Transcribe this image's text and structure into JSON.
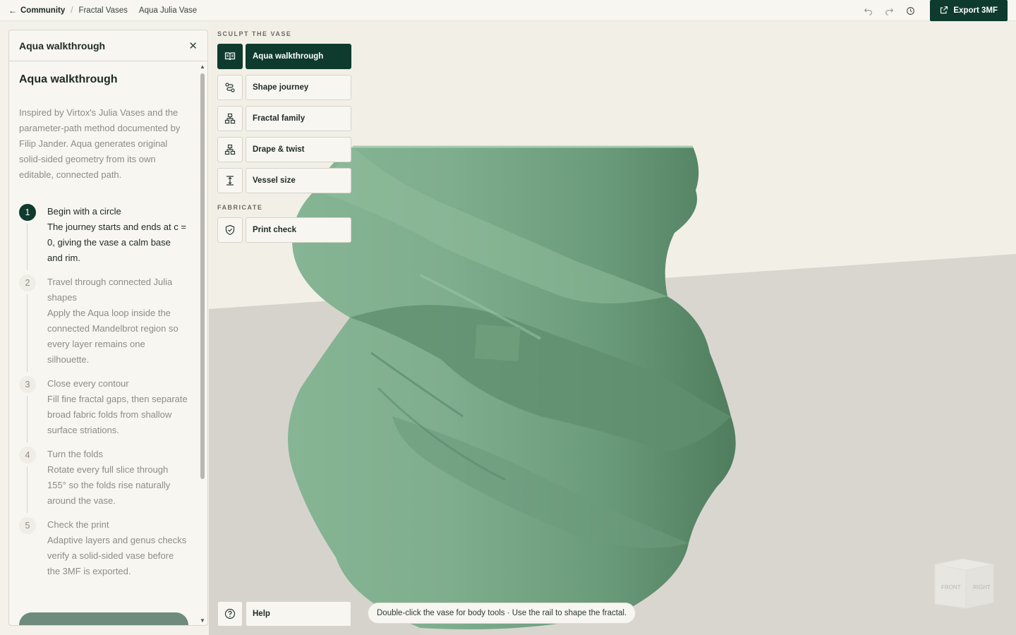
{
  "breadcrumb": {
    "back_label": "Community",
    "items": [
      "Fractal Vases"
    ],
    "current": "Aqua Julia Vase"
  },
  "toolbar": {
    "undo_icon": "undo-icon",
    "redo_icon": "redo-icon",
    "history_icon": "history-icon",
    "export_label": "Export 3MF"
  },
  "panel": {
    "header_title": "Aqua walkthrough",
    "title": "Aqua walkthrough",
    "intro": "Inspired by Virtox's Julia Vases and the parameter-path method documented by Filip Jander. Aqua generates original solid-sided geometry from its own editable, connected path.",
    "steps": [
      {
        "num": "1",
        "title": "Begin with a circle",
        "desc": "The journey starts and ends at c = 0, giving the vase a calm base and rim."
      },
      {
        "num": "2",
        "title": "Travel through connected Julia shapes",
        "desc": "Apply the Aqua loop inside the connected Mandelbrot region so every layer remains one silhouette."
      },
      {
        "num": "3",
        "title": "Close every contour",
        "desc": "Fill fine fractal gaps, then separate broad fabric folds from shallow surface striations."
      },
      {
        "num": "4",
        "title": "Turn the folds",
        "desc": "Rotate every full slice through 155° so the folds rise naturally around the vase."
      },
      {
        "num": "5",
        "title": "Check the print",
        "desc": "Adaptive layers and genus checks verify a solid-sided vase before the 3MF is exported."
      }
    ]
  },
  "rail": {
    "sculpt_label": "SCULPT THE VASE",
    "fabricate_label": "FABRICATE",
    "tools": [
      {
        "label": "Aqua walkthrough",
        "icon": "book-icon"
      },
      {
        "label": "Shape journey",
        "icon": "path-icon"
      },
      {
        "label": "Fractal family",
        "icon": "hierarchy-icon"
      },
      {
        "label": "Drape & twist",
        "icon": "hierarchy-icon"
      },
      {
        "label": "Vessel size",
        "icon": "height-icon"
      }
    ],
    "fab_tools": [
      {
        "label": "Print check",
        "icon": "shield-check-icon"
      }
    ],
    "help_label": "Help"
  },
  "viewport": {
    "hint": "Double-click the vase for body tools · Use the rail to shape the fractal.",
    "cube_front": "FRONT",
    "cube_right": "RIGHT",
    "colors": {
      "vase": "#7fae8e",
      "vase_shadow": "#4f7d5e",
      "floor": "#d9d6d0",
      "sky": "#f2efe6"
    }
  }
}
